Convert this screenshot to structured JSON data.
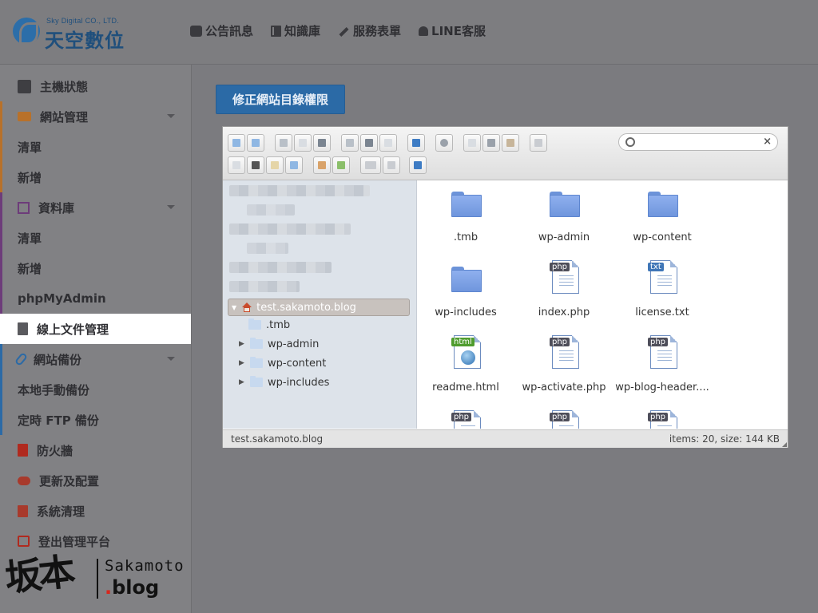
{
  "header": {
    "company_en": "Sky Digital CO., LTD.",
    "company_zh": "天空數位",
    "nav": [
      {
        "label": "公告訊息",
        "icon": "chat-icon"
      },
      {
        "label": "知識庫",
        "icon": "book-icon"
      },
      {
        "label": "服務表單",
        "icon": "pencil-icon"
      },
      {
        "label": "LINE客服",
        "icon": "bell-icon"
      }
    ]
  },
  "sidebar": {
    "host_status": "主機狀態",
    "website_mgmt": "網站管理",
    "website_list": "清單",
    "website_add": "新增",
    "database": "資料庫",
    "db_list": "清單",
    "db_add": "新增",
    "phpmyadmin": "phpMyAdmin",
    "online_files": "線上文件管理",
    "website_backup": "網站備份",
    "local_backup": "本地手動備份",
    "ftp_backup": "定時 FTP 備份",
    "firewall": "防火牆",
    "update_config": "更新及配置",
    "system_cleanup": "系統清理",
    "logout": "登出管理平台"
  },
  "main": {
    "fix_permissions_button": "修正網站目錄權限"
  },
  "file_manager": {
    "search_placeholder": "",
    "tree": {
      "root": "test.sakamoto.blog",
      "children": [
        ".tmb",
        "wp-admin",
        "wp-content",
        "wp-includes"
      ]
    },
    "files": [
      {
        "name": ".tmb",
        "type": "folder"
      },
      {
        "name": "wp-admin",
        "type": "folder"
      },
      {
        "name": "wp-content",
        "type": "folder"
      },
      {
        "name": "wp-includes",
        "type": "folder"
      },
      {
        "name": "index.php",
        "type": "php"
      },
      {
        "name": "license.txt",
        "type": "txt"
      },
      {
        "name": "readme.html",
        "type": "html"
      },
      {
        "name": "wp-activate.php",
        "type": "php"
      },
      {
        "name": "wp-blog-header....",
        "type": "php"
      },
      {
        "name": "",
        "type": "php"
      },
      {
        "name": "",
        "type": "php"
      },
      {
        "name": "",
        "type": "php"
      }
    ],
    "status_path": "test.sakamoto.blog",
    "status_info": "items: 20, size: 144 KB"
  },
  "watermark": {
    "top": "Sakamoto",
    "bottom_dot": ".",
    "bottom": "blog"
  }
}
